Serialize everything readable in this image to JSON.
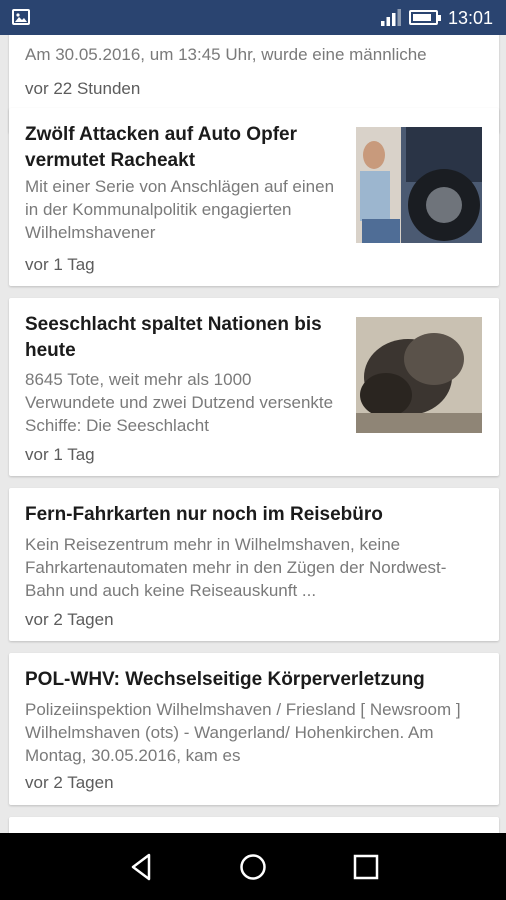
{
  "status_bar": {
    "time": "13:01",
    "icons": [
      "gallery-icon",
      "signal-icon",
      "battery-icon"
    ],
    "battery_level": 0.85
  },
  "colors": {
    "status_bar": "#2a4470",
    "background": "#e9e9e9",
    "title": "#1b1b1b",
    "description": "#7a7a7a"
  },
  "articles": [
    {
      "title": "",
      "description": "Am 30.05.2016, um 13:45 Uhr, wurde eine männliche",
      "age": "vor 22 Stunden"
    },
    {
      "title": "Zwölf Attacken auf Auto  Opfer vermutet Racheakt",
      "description": "Mit einer Serie von Anschlägen auf einen in der Kommunalpolitik engagierten Wilhelmshavener",
      "age": "vor 1 Tag"
    },
    {
      "title": "Seeschlacht spaltet Nationen bis heute",
      "description": "8645 Tote, weit mehr als 1000 Verwundete und zwei Dutzend versenkte Schiffe: Die Seeschlacht",
      "age": "vor 1 Tag"
    },
    {
      "title": "Fern-Fahrkarten nur noch im Reisebüro",
      "description": "Kein Reisezentrum mehr in Wilhelmshaven, keine Fahrkartenautomaten mehr in den Zügen der Nordwest-Bahn und auch keine Reiseauskunft ...",
      "age": "vor 2 Tagen"
    },
    {
      "title": "POL-WHV: Wechselseitige Körperverletzung",
      "description": "Polizeiinspektion Wilhelmshaven / Friesland [ Newsroom ] Wilhelmshaven (ots) - Wangerland/ Hohenkirchen. Am Montag, 30.05.2016, kam es",
      "age": "vor 2 Tagen"
    }
  ],
  "nav_bar": {
    "buttons": [
      "back-icon",
      "home-icon",
      "recents-icon"
    ]
  }
}
